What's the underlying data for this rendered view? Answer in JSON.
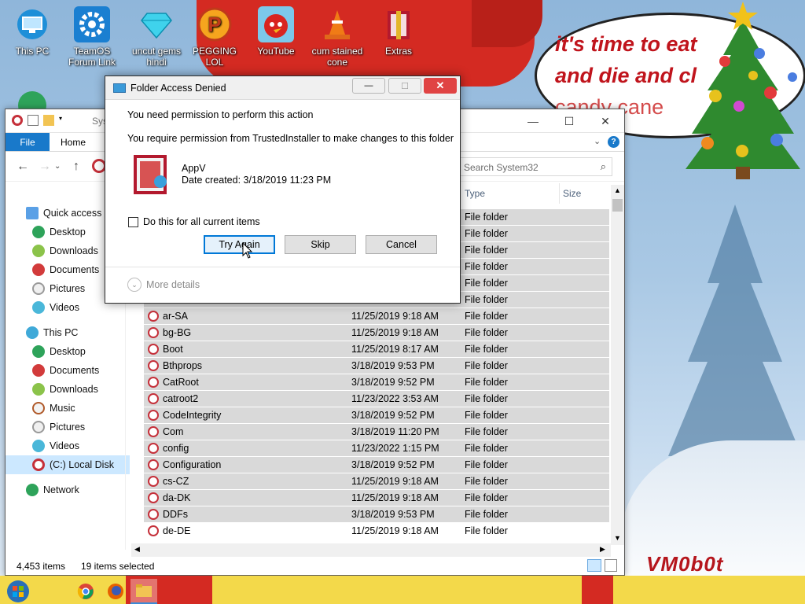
{
  "desktop": {
    "icons": [
      {
        "label": "This PC"
      },
      {
        "label": "TeamOS Forum Link"
      },
      {
        "label": "uncut gems hindi"
      },
      {
        "label": "PEGGING LOL"
      },
      {
        "label": "YouTube"
      },
      {
        "label": "cum stained cone"
      },
      {
        "label": "Extras"
      }
    ],
    "speech_line1": "it's time to eat",
    "speech_line2": "and die and cl",
    "speech_line3": "candy cane",
    "signature": "VM0b0t"
  },
  "explorer": {
    "title_faint": "Sys",
    "tabs": {
      "file": "File",
      "home": "Home"
    },
    "search_placeholder": "Search System32",
    "columns": {
      "type": "Type",
      "size": "Size"
    },
    "sidebar": [
      {
        "label": "Quick access"
      },
      {
        "label": "Desktop"
      },
      {
        "label": "Downloads"
      },
      {
        "label": "Documents"
      },
      {
        "label": "Pictures"
      },
      {
        "label": "Videos"
      },
      {
        "label": "This PC"
      },
      {
        "label": "Desktop"
      },
      {
        "label": "Documents"
      },
      {
        "label": "Downloads"
      },
      {
        "label": "Music"
      },
      {
        "label": "Pictures"
      },
      {
        "label": "Videos"
      },
      {
        "label": "(C:) Local Disk"
      },
      {
        "label": "Network"
      }
    ],
    "hidden_rows_type": "File folder",
    "rows": [
      {
        "name": "ar-SA",
        "date": "11/25/2019 9:18 AM",
        "type": "File folder"
      },
      {
        "name": "bg-BG",
        "date": "11/25/2019 9:18 AM",
        "type": "File folder"
      },
      {
        "name": "Boot",
        "date": "11/25/2019 8:17 AM",
        "type": "File folder"
      },
      {
        "name": "Bthprops",
        "date": "3/18/2019 9:53 PM",
        "type": "File folder"
      },
      {
        "name": "CatRoot",
        "date": "3/18/2019 9:52 PM",
        "type": "File folder"
      },
      {
        "name": "catroot2",
        "date": "11/23/2022 3:53 AM",
        "type": "File folder"
      },
      {
        "name": "CodeIntegrity",
        "date": "3/18/2019 9:52 PM",
        "type": "File folder"
      },
      {
        "name": "Com",
        "date": "3/18/2019 11:20 PM",
        "type": "File folder"
      },
      {
        "name": "config",
        "date": "11/23/2022 1:15 PM",
        "type": "File folder"
      },
      {
        "name": "Configuration",
        "date": "3/18/2019 9:52 PM",
        "type": "File folder"
      },
      {
        "name": "cs-CZ",
        "date": "11/25/2019 9:18 AM",
        "type": "File folder"
      },
      {
        "name": "da-DK",
        "date": "11/25/2019 9:18 AM",
        "type": "File folder"
      },
      {
        "name": "DDFs",
        "date": "3/18/2019 9:53 PM",
        "type": "File folder"
      },
      {
        "name": "de-DE",
        "date": "11/25/2019 9:18 AM",
        "type": "File folder"
      }
    ],
    "status": {
      "items": "4,453 items",
      "selected": "19 items selected"
    }
  },
  "dialog": {
    "title": "Folder Access Denied",
    "heading": "You need permission to perform this action",
    "message": "You require permission from TrustedInstaller to make changes to this folder",
    "item_name": "AppV",
    "item_date": "Date created: 3/18/2019 11:23 PM",
    "checkbox_label": "Do this for all current items",
    "buttons": {
      "try_again": "Try Again",
      "skip": "Skip",
      "cancel": "Cancel"
    },
    "more_details": "More details"
  },
  "colors": {
    "accent": "#1979ca",
    "selection": "#d9d9d9",
    "close_red": "#e04343"
  }
}
